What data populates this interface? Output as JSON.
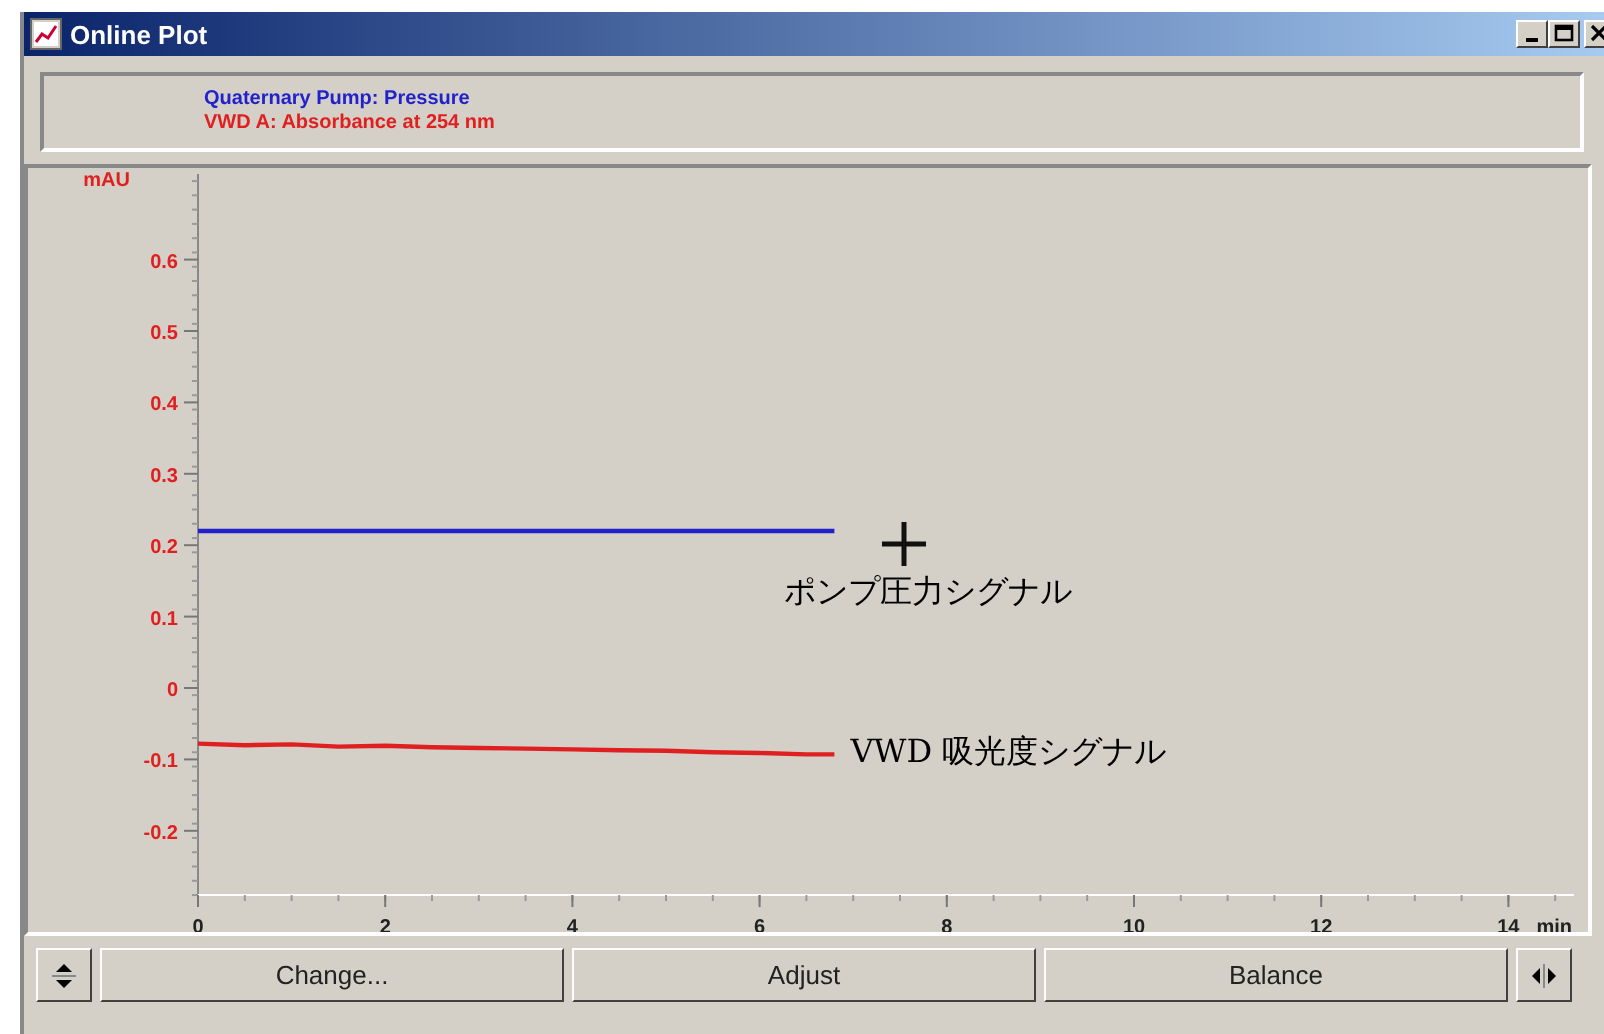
{
  "window": {
    "title": "Online Plot"
  },
  "plot": {
    "chart_data": {
      "type": "line",
      "xlabel": "min",
      "ylabel": "mAU",
      "xlim": [
        0,
        14.7
      ],
      "ylim": [
        -0.29,
        0.72
      ],
      "xticks": [
        0,
        2,
        4,
        6,
        8,
        10,
        12,
        14
      ],
      "yticks": [
        -0.2,
        -0.1,
        0,
        0.1,
        0.2,
        0.3,
        0.4,
        0.5,
        0.6
      ],
      "x": [
        0,
        0.5,
        1,
        1.5,
        2,
        2.5,
        3,
        3.5,
        4,
        4.5,
        5,
        5.5,
        6,
        6.5,
        6.8
      ],
      "series": [
        {
          "name": "Quaternary Pump: Pressure",
          "color": "#2222cc",
          "values": [
            0.22,
            0.22,
            0.22,
            0.22,
            0.22,
            0.22,
            0.22,
            0.22,
            0.22,
            0.22,
            0.22,
            0.22,
            0.22,
            0.22,
            0.22
          ]
        },
        {
          "name": "VWD A: Absorbance at 254 nm",
          "color": "#e02020",
          "values": [
            -0.078,
            -0.08,
            -0.079,
            -0.082,
            -0.081,
            -0.083,
            -0.084,
            -0.085,
            -0.086,
            -0.087,
            -0.088,
            -0.09,
            -0.091,
            -0.093,
            -0.093
          ]
        }
      ],
      "annotations": [
        "ポンプ圧力シグナル",
        "VWD 吸光度シグナル"
      ]
    }
  },
  "buttons": [
    "Change...",
    "Adjust",
    "Balance"
  ]
}
